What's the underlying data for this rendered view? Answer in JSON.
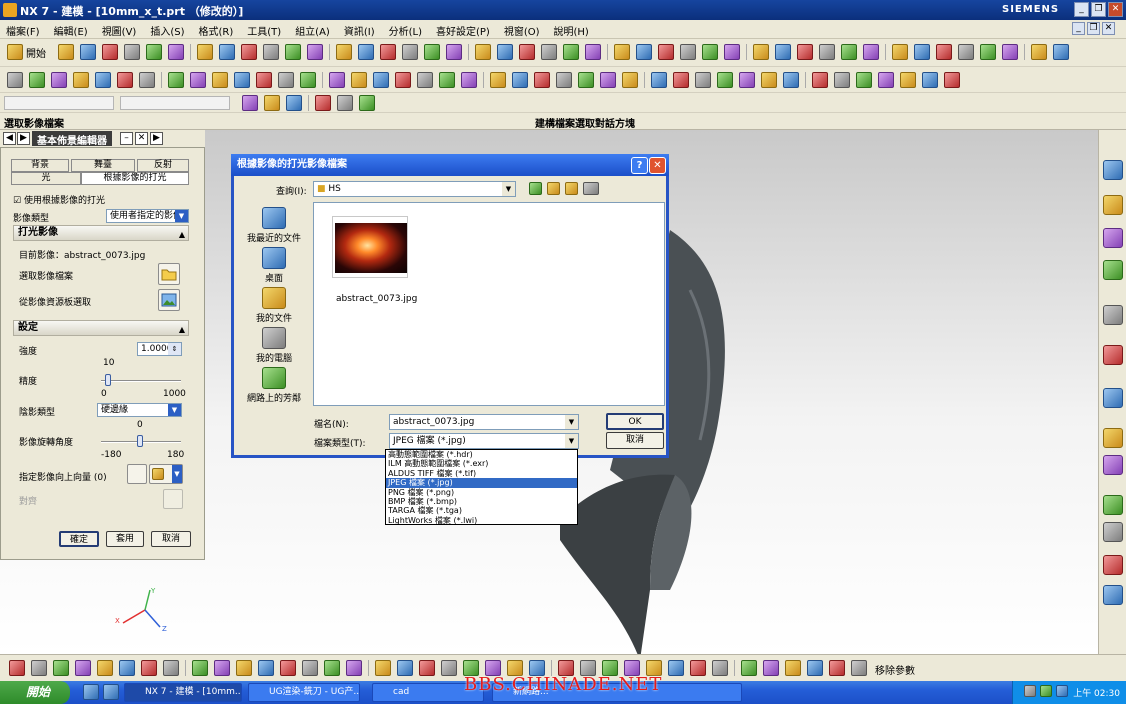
{
  "window": {
    "title": "NX 7 - 建模 - [10mm_x_t.prt （修改的）]",
    "brand": "SIEMENS"
  },
  "menu": [
    "檔案(F)",
    "編輯(E)",
    "視圖(V)",
    "插入(S)",
    "格式(R)",
    "工具(T)",
    "組立(A)",
    "資訊(I)",
    "分析(L)",
    "喜好設定(P)",
    "視窗(O)",
    "說明(H)"
  ],
  "toolbar": {
    "start_label": "開始"
  },
  "cue": {
    "left": "選取影像檔案",
    "center": "建構檔案選取對話方塊"
  },
  "nav": {
    "title": "基本佈景編輯器"
  },
  "panel": {
    "tabs": [
      "背景",
      "舞臺",
      "反射",
      "光",
      "根據影像的打光"
    ],
    "use_image_lighting": "使用根據影像的打光",
    "image_type_label": "影像類型",
    "image_type_value": "使用者指定的影像",
    "group_image": "打光影像",
    "current_image": "目前影像：abstract_0073.jpg",
    "select_image_file": "選取影像檔案",
    "select_from_palette": "從影像資源板選取",
    "group_settings": "設定",
    "intensity_label": "強度",
    "intensity_value": "1.0000",
    "precision_label": "精度",
    "precision_current": "10",
    "precision_min": "0",
    "precision_max": "1000",
    "shadow_type_label": "陰影類型",
    "shadow_type_value": "硬邊緣",
    "rotation_label": "影像旋轉角度",
    "rotation_current": "0",
    "rotation_min": "-180",
    "rotation_max": "180",
    "up_vector_label": "指定影像向上向量 (0)",
    "align_label": "對齊",
    "ok": "確定",
    "apply": "套用",
    "cancel": "取消"
  },
  "dialog": {
    "title": "根據影像的打光影像檔案",
    "lookin_label": "查詢(I):",
    "lookin_value": "HS",
    "places": [
      "我最近的文件",
      "桌面",
      "我的文件",
      "我的電腦",
      "網路上的芳鄰"
    ],
    "file_name": "abstract_0073.jpg",
    "filename_label": "檔名(N):",
    "filename_value": "abstract_0073.jpg",
    "filetype_label": "檔案類型(T):",
    "filetype_value": "JPEG 檔案 (*.jpg)",
    "ok": "OK",
    "cancel": "取消",
    "help_btn": "?",
    "close_btn": "✕"
  },
  "dropdown": {
    "items": [
      "高動態範圍檔案 (*.hdr)",
      "ILM 高動態範圍檔案 (*.exr)",
      "ALDUS TIFF 檔案 (*.tif)",
      "JPEG 檔案 (*.jpg)",
      "PNG 檔案 (*.png)",
      "BMP 檔案 (*.bmp)",
      "TARGA 檔案 (*.tga)",
      "LightWorks 檔案 (*.lwi)"
    ],
    "selected_index": 3
  },
  "bottom_toolbar": {
    "remove_params": "移除參數"
  },
  "taskbar": {
    "start": "開始",
    "tasks": [
      "NX 7 - 建模 - [10mm...",
      "UG渲染-銑刀 - UG产...",
      "cad",
      "新網路..."
    ],
    "clock": "上午 02:30"
  },
  "watermark": "BBS.CHINADE.NET",
  "triad": {
    "x": "X",
    "y": "Y",
    "z": "Z"
  },
  "colors": {
    "title_bar": "#0b2f7c",
    "dialog_title": "#1b4fc8",
    "selection": "#316ac5",
    "panel_bg": "#ece9d8"
  }
}
